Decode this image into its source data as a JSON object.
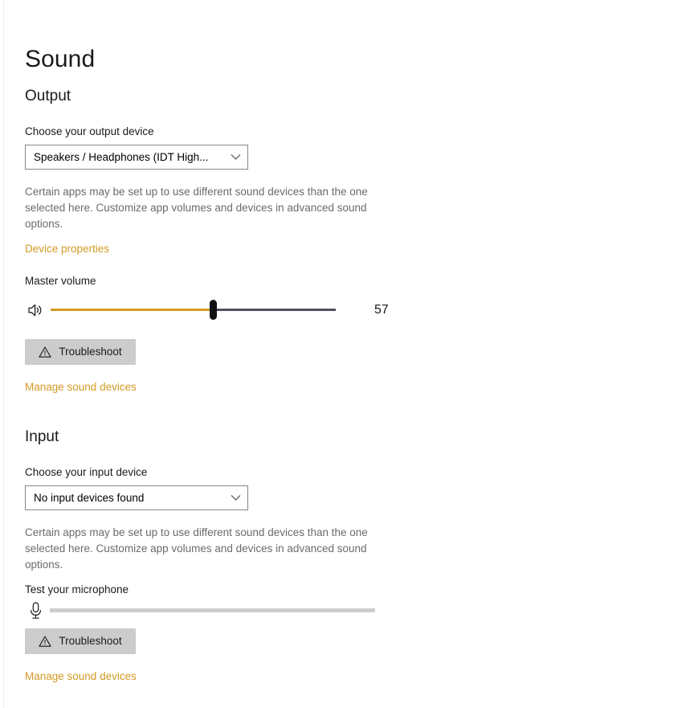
{
  "page": {
    "title": "Sound"
  },
  "output": {
    "heading": "Output",
    "device_label": "Choose your output device",
    "device_value": "Speakers / Headphones (IDT High...",
    "description": "Certain apps may be set up to use different sound devices than the one selected here. Customize app volumes and devices in advanced sound options.",
    "device_properties_link": "Device properties",
    "volume_label": "Master volume",
    "volume_value": "57",
    "volume_percent": 57,
    "speaker_icon": "speaker-volume-icon",
    "troubleshoot_label": "Troubleshoot",
    "troubleshoot_icon": "warning-triangle-icon",
    "manage_link": "Manage sound devices"
  },
  "input": {
    "heading": "Input",
    "device_label": "Choose your input device",
    "device_value": "No input devices found",
    "description": "Certain apps may be set up to use different sound devices than the one selected here. Customize app volumes and devices in advanced sound options.",
    "test_mic_label": "Test your microphone",
    "mic_icon": "microphone-icon",
    "mic_level_percent": 0,
    "troubleshoot_label": "Troubleshoot",
    "troubleshoot_icon": "warning-triangle-icon",
    "manage_link": "Manage sound devices"
  },
  "icons": {
    "chevron": "chevron-down-icon"
  },
  "colors": {
    "accent_link": "#d39a24",
    "slider_fill": "#d39a24",
    "slider_track": "#4e535c",
    "button_bg": "#cccccc",
    "text": "#1a1a1a",
    "muted_text": "#6b6b6b"
  }
}
